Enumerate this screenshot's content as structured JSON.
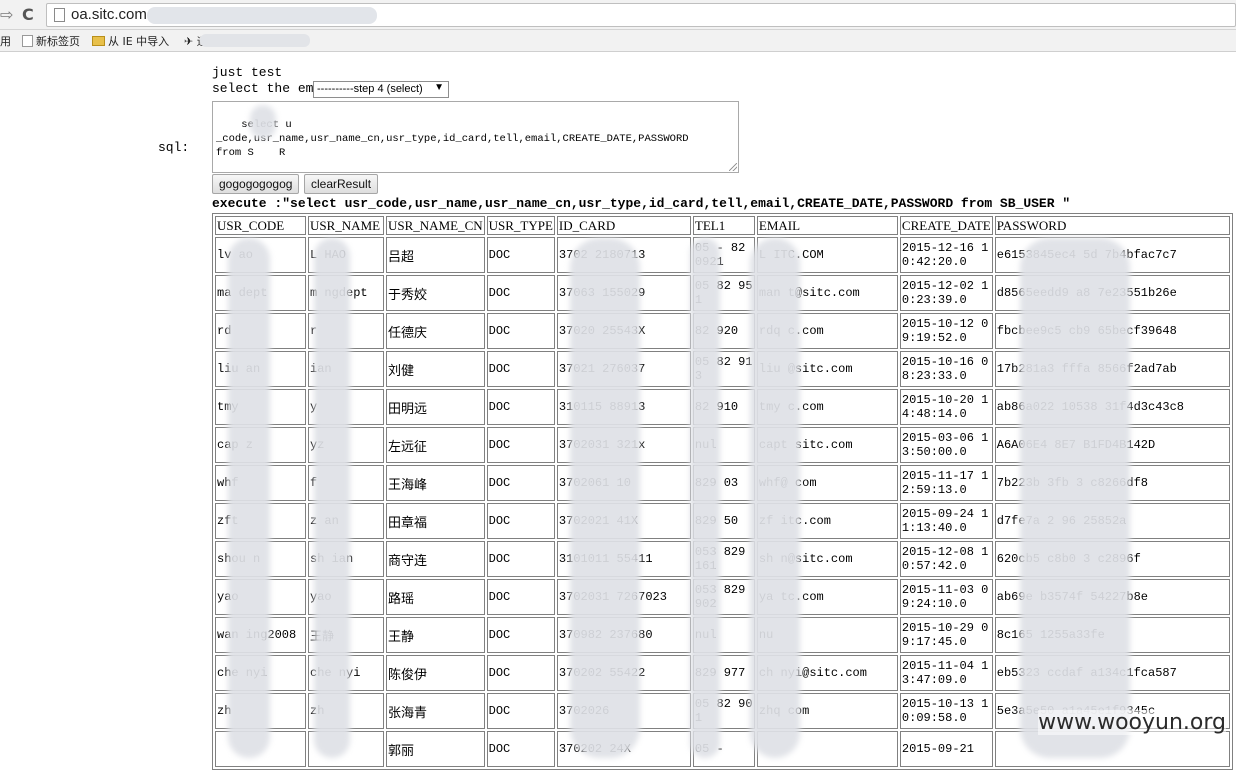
{
  "browser": {
    "url": "oa.sitc.com",
    "bookmarks": [
      "用",
      "新标签页",
      "从 IE 中导入",
      "迎"
    ]
  },
  "page": {
    "title": "just test",
    "select_label": "select the em",
    "step_select_value": "----------step 4 (select)",
    "sql_label": "sql:",
    "sql_text": "select u  _code,usr_name,usr_name_cn,usr_type,id_card,tell,email,CREATE_DATE,PASSWORD\nfrom S    R",
    "go_button": "gogogogogog",
    "clear_button": "clearResult",
    "execute_text": "execute :\"select usr_code,usr_name,usr_name_cn,usr_type,id_card,tell,email,CREATE_DATE,PASSWORD from SB_USER \""
  },
  "table": {
    "headers": [
      "USR_CODE",
      "USR_NAME",
      "USR_NAME_CN",
      "USR_TYPE",
      "ID_CARD",
      "TEL1",
      "EMAIL",
      "CREATE_DATE",
      "PASSWORD"
    ],
    "rows": [
      [
        "lv  ao",
        "L  HAO",
        "吕超",
        "DOC",
        "3702      2180713",
        "05  - 82  0921",
        "L   ITC.COM",
        "2015-12-16 10:42:20.0",
        "e6153845ec4   5d   7b4bfac7c7"
      ],
      [
        "ma   dept",
        "m   ngdept",
        "于秀姣",
        "DOC",
        "37063     155029",
        "05  82  951",
        "man    t@sitc.com",
        "2015-12-02 10:23:39.0",
        "d8565eedd9   a8   7e23551b26e"
      ],
      [
        "rd",
        "r",
        "任德庆",
        "DOC",
        "37020     25543X",
        "82  920",
        "rdq    c.com",
        "2015-10-12 09:19:52.0",
        "fbcbee9c5   cb9   65becf39648"
      ],
      [
        "liu  an",
        "   ian",
        "刘健",
        "DOC",
        "37021     276037",
        "05  82  913",
        "liu    @sitc.com",
        "2015-10-16 08:23:33.0",
        "17b281a3   fffa   8566f2ad7ab"
      ],
      [
        "tmy",
        "  y",
        "田明远",
        "DOC",
        "310115    88913",
        "82  910",
        "tmy    c.com",
        "2015-10-20 14:48:14.0",
        "ab86a022   10538   31f4d3c43c8"
      ],
      [
        "cap  z",
        "  yz",
        "左远征",
        "DOC",
        "3702031    321x",
        "nul",
        "capt   sitc.com",
        "2015-03-06 13:50:00.0",
        "A6A06E4   8E7   B1FD4B142D"
      ],
      [
        "whf",
        "  f",
        "王海峰",
        "DOC",
        "3702061     10",
        "829  03",
        "whf@    com",
        "2015-11-17 12:59:13.0",
        "7b223b   3fb   3   c8266df8"
      ],
      [
        "zft",
        "z   an",
        "田章福",
        "DOC",
        "3702021    41X",
        "829  50",
        "zf   itc.com",
        "2015-09-24 11:13:40.0",
        "d7fe7a   2   96   25852a"
      ],
      [
        "shou  n",
        "sh   ian",
        "商守连",
        "DOC",
        "3101011    55411",
        "053 829  161",
        "sh    n@sitc.com",
        "2015-12-08 10:57:42.0",
        "620cb5   c8b0   3   c2896f"
      ],
      [
        "yao",
        "yao",
        "路瑶",
        "DOC",
        "3702031    7267023",
        "053 829  902",
        "ya    tc.com",
        "2015-11-03 09:24:10.0",
        "ab69e   b3574f   54227b8e"
      ],
      [
        "wan   ing2008",
        "王静",
        "王静",
        "DOC",
        "370982     237680",
        "nul",
        "nu",
        "2015-10-29 09:17:45.0",
        "8c165     1255a33fe"
      ],
      [
        "che  nyi",
        "che  nyi",
        "陈俊伊",
        "DOC",
        "370202     55422",
        "829  977",
        "ch   nyi@sitc.com",
        "2015-11-04 13:47:09.0",
        "eb5323   ccdaf   a134c1fca587"
      ],
      [
        "zh",
        "zh",
        "张海青",
        "DOC",
        "3702026",
        "05  82  901",
        "zhq    com",
        "2015-10-13 10:09:58.0",
        "5e3a5e50    a1a45e1f9345c"
      ],
      [
        "",
        "",
        "郭丽",
        "DOC",
        "370202       24X",
        "05  -",
        "",
        "2015-09-21",
        ""
      ]
    ]
  },
  "watermark": "www.wooyun.org",
  "colors": {
    "redaction": "#dee1e6",
    "border": "#808080"
  }
}
